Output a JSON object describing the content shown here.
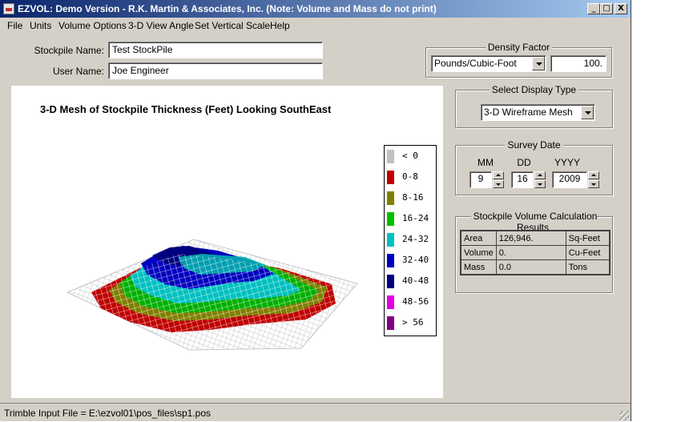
{
  "window": {
    "title": "EZVOL: Demo Version - R.K. Martin & Associates, Inc. (Note: Volume and Mass do not print)",
    "minimize_label": "_",
    "maximize_label": "□",
    "close_label": "X"
  },
  "menu": {
    "items": [
      {
        "label": "File"
      },
      {
        "label": "Units"
      },
      {
        "label": "Volume Options"
      },
      {
        "label": "3-D View Angle"
      },
      {
        "label": "Set Vertical Scale"
      },
      {
        "label": "Help"
      }
    ]
  },
  "form": {
    "stockpile_label": "Stockpile Name:",
    "stockpile_value": "Test StockPile",
    "user_label": "User Name:",
    "user_value": "Joe Engineer"
  },
  "density": {
    "group_title": "Density Factor",
    "unit_value": "Pounds/Cubic-Foot",
    "value": "100."
  },
  "display_type": {
    "group_title": "Select Display Type",
    "value": "3-D Wireframe Mesh"
  },
  "survey_date": {
    "group_title": "Survey Date",
    "mm_label": "MM",
    "dd_label": "DD",
    "yyyy_label": "YYYY",
    "mm_value": "9",
    "dd_value": "16",
    "yyyy_value": "2009"
  },
  "results": {
    "group_title": "Stockpile Volume Calculation Results",
    "rows": [
      {
        "name": "Area",
        "value": "126,946.",
        "unit": "Sq-Feet"
      },
      {
        "name": "Volume",
        "value": "0.",
        "unit": "Cu-Feet"
      },
      {
        "name": "Mass",
        "value": "0.0",
        "unit": "Tons"
      }
    ]
  },
  "plot": {
    "title": "3-D Mesh of Stockpile Thickness (Feet) Looking SouthEast",
    "legend": [
      {
        "label": "< 0",
        "color": "#c0c0c0"
      },
      {
        "label": "0-8",
        "color": "#c00000"
      },
      {
        "label": "8-16",
        "color": "#808000"
      },
      {
        "label": "16-24",
        "color": "#00c000"
      },
      {
        "label": "24-32",
        "color": "#00c0c0"
      },
      {
        "label": "32-40",
        "color": "#0000c0"
      },
      {
        "label": "40-48",
        "color": "#000080"
      },
      {
        "label": "48-56",
        "color": "#e000e0"
      },
      {
        "label": "> 56",
        "color": "#800080"
      }
    ]
  },
  "status": {
    "text": "Trimble Input File = E:\\ezvol01\\pos_files\\sp1.pos"
  }
}
